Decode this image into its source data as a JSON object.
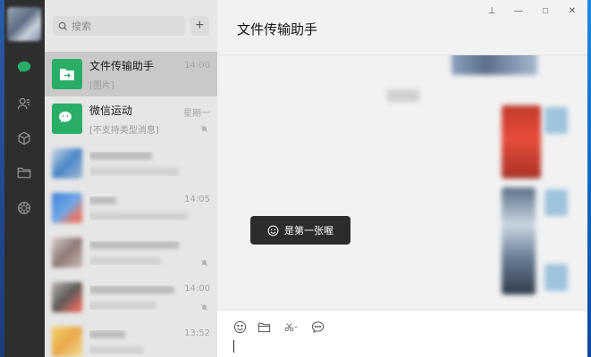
{
  "search": {
    "placeholder": "搜索",
    "add_label": "+"
  },
  "chats": [
    {
      "name": "文件传输助手",
      "preview": "[图片]",
      "time": "14:00",
      "active": true
    },
    {
      "name": "微信运动",
      "preview": "[不支持类型消息]",
      "time": "星期一",
      "muted": true
    },
    {
      "name": "",
      "preview": "",
      "time": ""
    },
    {
      "name": "",
      "preview": "",
      "time": "14:05"
    },
    {
      "name": "",
      "preview": "",
      "time": "",
      "muted": true
    },
    {
      "name": "",
      "preview": "",
      "time": "14:00",
      "muted": true
    },
    {
      "name": "",
      "preview": "",
      "time": "13:52"
    }
  ],
  "chat_header": {
    "title": "文件传输助手"
  },
  "window_controls": {
    "pin": "⊥",
    "minimize": "—",
    "maximize": "□",
    "close": "✕"
  },
  "toast": {
    "text": "是第一张喔",
    "icon": "smile-icon"
  },
  "composer": {
    "tools": [
      "emoji-icon",
      "folder-icon",
      "scissors-icon",
      "chat-bubble-icon"
    ]
  },
  "colors": {
    "accent_green": "#2aae67",
    "rail": "#2e2e2e",
    "list_bg": "#e6e6e6",
    "active_item": "#c9c9c9"
  }
}
